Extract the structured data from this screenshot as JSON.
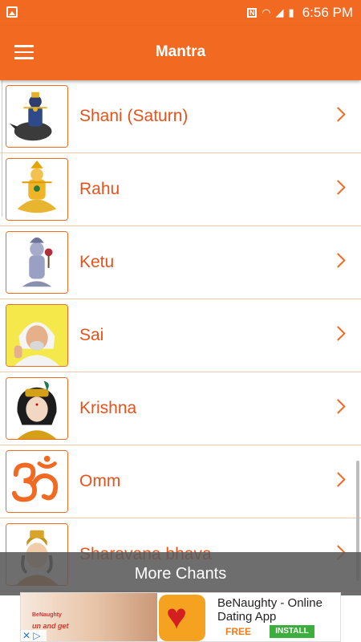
{
  "status_bar": {
    "time": "6:56 PM",
    "nfc": "N"
  },
  "app_bar": {
    "title": "Mantra"
  },
  "mantras": [
    {
      "label": "Shani (Saturn)"
    },
    {
      "label": "Rahu"
    },
    {
      "label": "Ketu"
    },
    {
      "label": "Sai"
    },
    {
      "label": "Krishna"
    },
    {
      "label": "Omm"
    },
    {
      "label": "Sharavana bhava"
    }
  ],
  "more_chants": {
    "label": "More Chants"
  },
  "ad": {
    "title": "BeNaughty - Online Dating App",
    "price": "FREE",
    "install_label": "INSTALL",
    "brand_small": "BeNaughty",
    "tagline": "un and get",
    "close_glyph": "✕ ▷"
  },
  "colors": {
    "accent": "#f26a21",
    "label": "#e8521a"
  }
}
